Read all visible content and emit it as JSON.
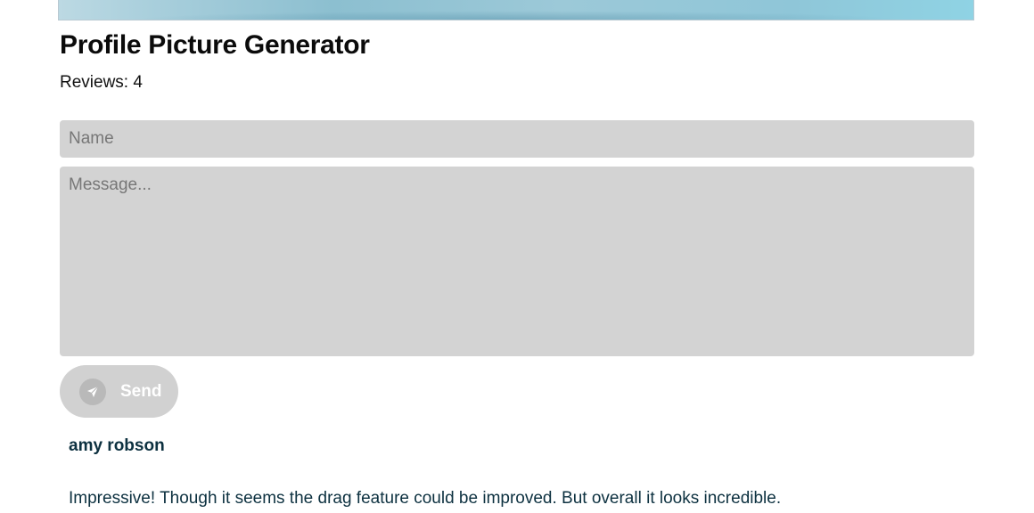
{
  "header": {
    "title": "Profile Picture Generator",
    "reviews_label": "Reviews: 4"
  },
  "form": {
    "name_placeholder": "Name",
    "name_value": "",
    "message_placeholder": "Message...",
    "message_value": "",
    "send_label": "Send",
    "send_icon": "paper-plane-icon"
  },
  "reviews": [
    {
      "author": "amy robson",
      "text": "Impressive! Though it seems the drag feature could be improved. But overall it looks incredible."
    }
  ],
  "colors": {
    "input_background": "#d3d3d3",
    "button_background": "#d1d1d1",
    "review_text": "#0d3140"
  }
}
